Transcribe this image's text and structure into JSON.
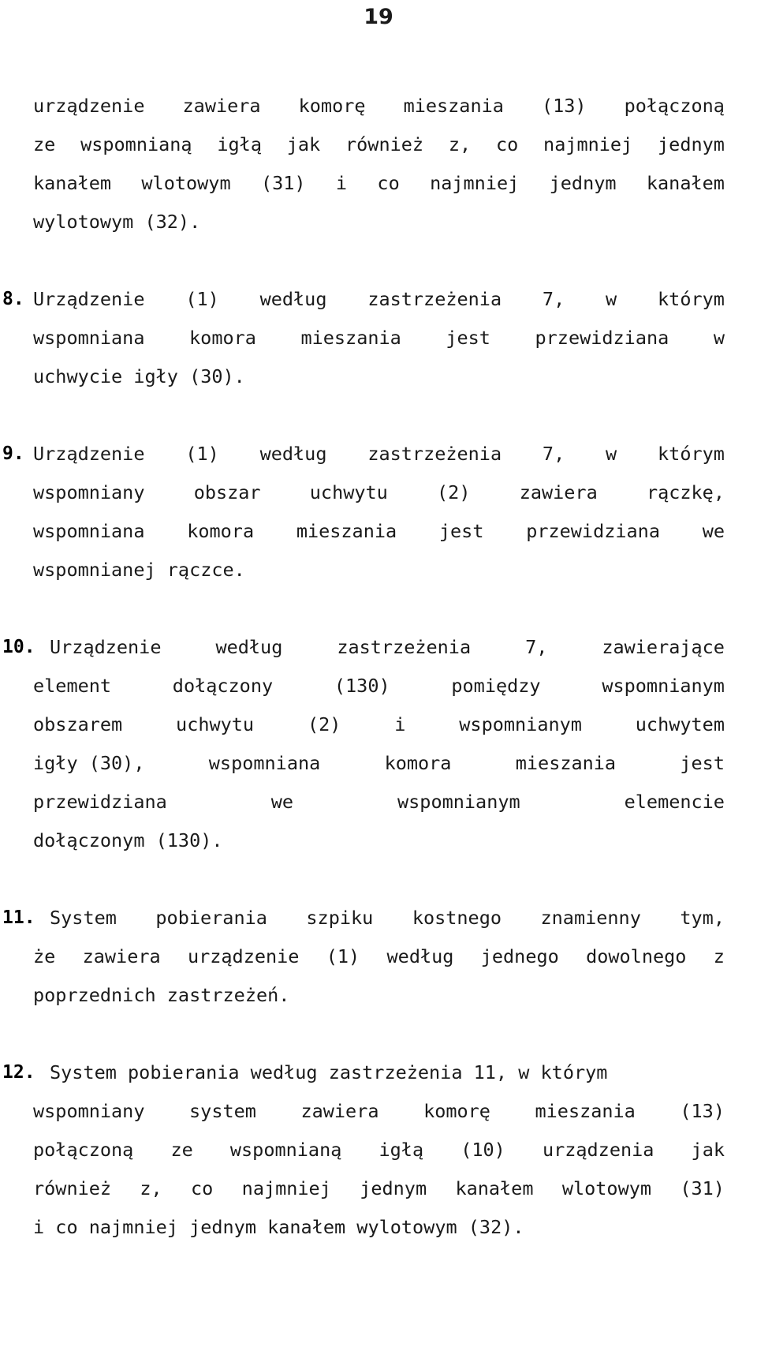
{
  "page": {
    "number": "19",
    "language": "pl",
    "text_color": "#1a1a1a"
  },
  "document": {
    "continued_paragraph": {
      "name": "continued-claim-7",
      "lines": [
        {
          "align": "justify",
          "words": [
            "urządzenie",
            "zawiera",
            "komorę",
            "mieszania",
            "(13)",
            "połączoną"
          ]
        },
        {
          "align": "justify",
          "words": [
            "ze",
            "wspomnianą",
            "igłą",
            "jak",
            "również",
            "z,",
            "co",
            "najmniej",
            "jednym"
          ]
        },
        {
          "align": "justify",
          "words": [
            "kanałem",
            "wlotowym",
            "(31)",
            "i",
            "co",
            "najmniej",
            "jednym",
            "kanałem"
          ]
        },
        {
          "align": "flush",
          "words": [
            "wylotowym (32)."
          ]
        }
      ]
    },
    "claims": [
      {
        "number": "8.",
        "wide": false,
        "lines": [
          {
            "align": "justify",
            "words": [
              "Urządzenie",
              "(1)",
              "według",
              "zastrzeżenia",
              "7,",
              "w",
              "którym"
            ]
          },
          {
            "align": "justify",
            "words": [
              "wspomniana",
              "komora",
              "mieszania",
              "jest",
              "przewidziana",
              "w"
            ]
          },
          {
            "align": "flush",
            "words": [
              "uchwycie igły (30)."
            ]
          }
        ]
      },
      {
        "number": "9.",
        "wide": false,
        "lines": [
          {
            "align": "justify",
            "words": [
              "Urządzenie",
              "(1)",
              "według",
              "zastrzeżenia",
              "7,",
              "w",
              "którym"
            ]
          },
          {
            "align": "justify",
            "words": [
              "wspomniany",
              "obszar",
              "uchwytu",
              "(2)",
              "zawiera",
              "rączkę,"
            ]
          },
          {
            "align": "justify",
            "words": [
              "wspomniana",
              "komora",
              "mieszania",
              "jest",
              "przewidziana",
              "we"
            ]
          },
          {
            "align": "flush",
            "words": [
              "wspomnianej rączce."
            ]
          }
        ]
      },
      {
        "number": "10.",
        "wide": true,
        "lines": [
          {
            "align": "justify",
            "words": [
              "Urządzenie",
              "według",
              "zastrzeżenia",
              "7,",
              "zawierające"
            ]
          },
          {
            "align": "justify",
            "words": [
              "element",
              "dołączony",
              "(130)",
              "pomiędzy",
              "wspomnianym"
            ]
          },
          {
            "align": "justify",
            "words": [
              "obszarem",
              "uchwytu",
              "(2)",
              "i",
              "wspomnianym",
              "uchwytem"
            ]
          },
          {
            "align": "justify",
            "words": [
              "igły (30),",
              "wspomniana",
              "komora",
              "mieszania",
              "jest"
            ]
          },
          {
            "align": "justify",
            "words": [
              "przewidziana",
              "we",
              "wspomnianym",
              "elemencie"
            ]
          },
          {
            "align": "flush",
            "words": [
              "dołączonym (130)."
            ]
          }
        ]
      },
      {
        "number": "11.",
        "wide": true,
        "lines": [
          {
            "align": "justify",
            "words": [
              "System",
              "pobierania",
              "szpiku",
              "kostnego",
              "znamienny",
              "tym,"
            ]
          },
          {
            "align": "justify",
            "words": [
              "że",
              "zawiera",
              "urządzenie",
              "(1)",
              "według",
              "jednego",
              "dowolnego",
              "z"
            ]
          },
          {
            "align": "flush",
            "words": [
              "poprzednich zastrzeżeń."
            ]
          }
        ]
      },
      {
        "number": "12.",
        "wide": true,
        "lines": [
          {
            "align": "flush",
            "words": [
              "System pobierania według zastrzeżenia 11, w którym"
            ]
          },
          {
            "align": "justify",
            "words": [
              "wspomniany",
              "system",
              "zawiera",
              "komorę",
              "mieszania",
              "(13)"
            ]
          },
          {
            "align": "justify",
            "words": [
              "połączoną",
              "ze",
              "wspomnianą",
              "igłą",
              "(10)",
              "urządzenia",
              "jak"
            ]
          },
          {
            "align": "justify",
            "words": [
              "również",
              "z,",
              "co",
              "najmniej",
              "jednym",
              "kanałem",
              "wlotowym",
              "(31)"
            ]
          },
          {
            "align": "flush",
            "words": [
              "i co najmniej jednym kanałem wylotowym (32)."
            ]
          }
        ]
      }
    ]
  }
}
